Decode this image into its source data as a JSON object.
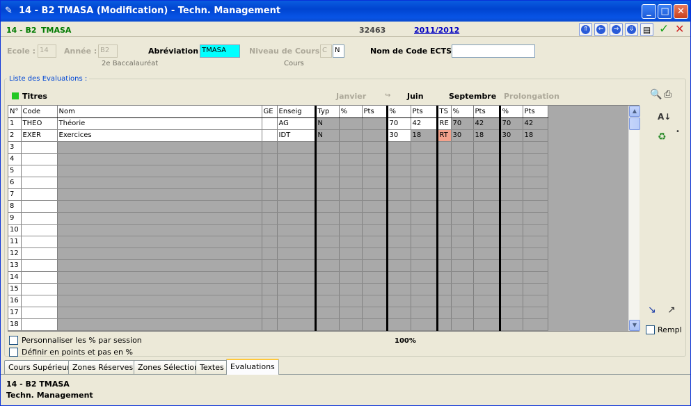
{
  "window": {
    "title": "14 - B2    TMASA (Modification) - Techn. Management",
    "icon": "app-icon"
  },
  "infobar": {
    "class_code": "14 - B2",
    "abbrev": "TMASA",
    "record_number": "32463",
    "school_year": "2011/2012"
  },
  "form": {
    "ecole_label": "Ecole :",
    "ecole_value": "14",
    "annee_label": "Année :",
    "annee_value": "B2",
    "annee_sub": "2e Baccalauréat",
    "abrev_label": "Abréviation :",
    "abrev_value": "TMASA",
    "niveau_label": "Niveau de Cours :",
    "niveau_value1": "C",
    "niveau_value2": "N",
    "niveau_sub": "Cours",
    "ects_label": "Nom de Code ECTS :",
    "ects_value": ""
  },
  "group_title": "Liste des Evaluations :",
  "titres_label": "Titres",
  "sessions": {
    "janvier": "Janvier",
    "juin": "Juin",
    "septembre": "Septembre",
    "prolongation": "Prolongation"
  },
  "columns": [
    "N°",
    "Code",
    "Nom",
    "GE",
    "Enseig",
    "Typ",
    "%",
    "Pts",
    "%",
    "Pts",
    "TS",
    "%",
    "Pts",
    "%",
    "Pts"
  ],
  "rows": [
    {
      "n": "1",
      "code": "THEO",
      "nom": "Théorie",
      "ge": "",
      "enseig": "AG",
      "typ": "N",
      "j_pct": "",
      "j_pts": "",
      "ju_pct": "70",
      "ju_pts": "42",
      "ts": "RE",
      "s_pct": "70",
      "s_pts": "42",
      "p_pct": "70",
      "p_pts": "42"
    },
    {
      "n": "2",
      "code": "EXER",
      "nom": "Exercices",
      "ge": "",
      "enseig": "IDT",
      "typ": "N",
      "j_pct": "",
      "j_pts": "",
      "ju_pct": "30",
      "ju_pts": "18",
      "ts": "RT",
      "s_pct": "30",
      "s_pts": "18",
      "p_pct": "30",
      "p_pts": "18"
    },
    {
      "n": "3"
    },
    {
      "n": "4"
    },
    {
      "n": "5"
    },
    {
      "n": "6"
    },
    {
      "n": "7"
    },
    {
      "n": "8"
    },
    {
      "n": "9"
    },
    {
      "n": "10"
    },
    {
      "n": "11"
    },
    {
      "n": "12"
    },
    {
      "n": "13"
    },
    {
      "n": "14"
    },
    {
      "n": "15"
    },
    {
      "n": "16"
    },
    {
      "n": "17"
    },
    {
      "n": "18"
    }
  ],
  "options": {
    "perso_label": "Personnaliser les % par session",
    "points_label": "Définir en points et pas en %",
    "rempl_label": "Rempl"
  },
  "total_percent": "100%",
  "tabs": [
    "Cours Supérieur",
    "Zones Réserves",
    "Zones Sélection",
    "Textes",
    "Evaluations"
  ],
  "footer": {
    "line1": "14 - B2    TMASA",
    "line2": "Techn. Management"
  },
  "colors": {
    "accent": "#007a00",
    "rt_cell": "#f4a28c",
    "abrev_field": "#00ffff",
    "titres_square": "#22c822"
  }
}
